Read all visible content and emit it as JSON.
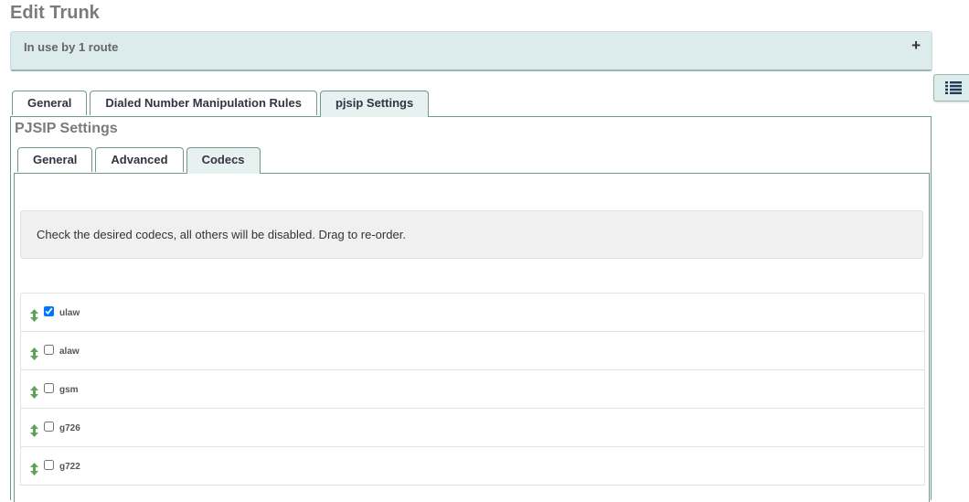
{
  "page": {
    "title": "Edit Trunk"
  },
  "route_panel": {
    "text": "In use by 1 route",
    "expand_symbol": "+"
  },
  "tabs": [
    {
      "label": "General",
      "active": false
    },
    {
      "label": "Dialed Number Manipulation Rules",
      "active": false
    },
    {
      "label": "pjsip Settings",
      "active": true
    }
  ],
  "section": {
    "title": "PJSIP Settings"
  },
  "subtabs": [
    {
      "label": "General",
      "active": false
    },
    {
      "label": "Advanced",
      "active": false
    },
    {
      "label": "Codecs",
      "active": true
    }
  ],
  "help": {
    "text": "Check the desired codecs, all others will be disabled. Drag to re-order."
  },
  "codecs": [
    {
      "name": "ulaw",
      "checked": true
    },
    {
      "name": "alaw",
      "checked": false
    },
    {
      "name": "gsm",
      "checked": false
    },
    {
      "name": "g726",
      "checked": false
    },
    {
      "name": "g722",
      "checked": false
    }
  ],
  "icons": {
    "side_toggle": "list-icon",
    "drag": "drag-arrows-icon"
  },
  "colors": {
    "accent": "#6e9a8d",
    "panel_bg": "#dcebeb",
    "active_tab_bg": "#e6f1f0",
    "drag_arrow": "#5aa55a"
  }
}
